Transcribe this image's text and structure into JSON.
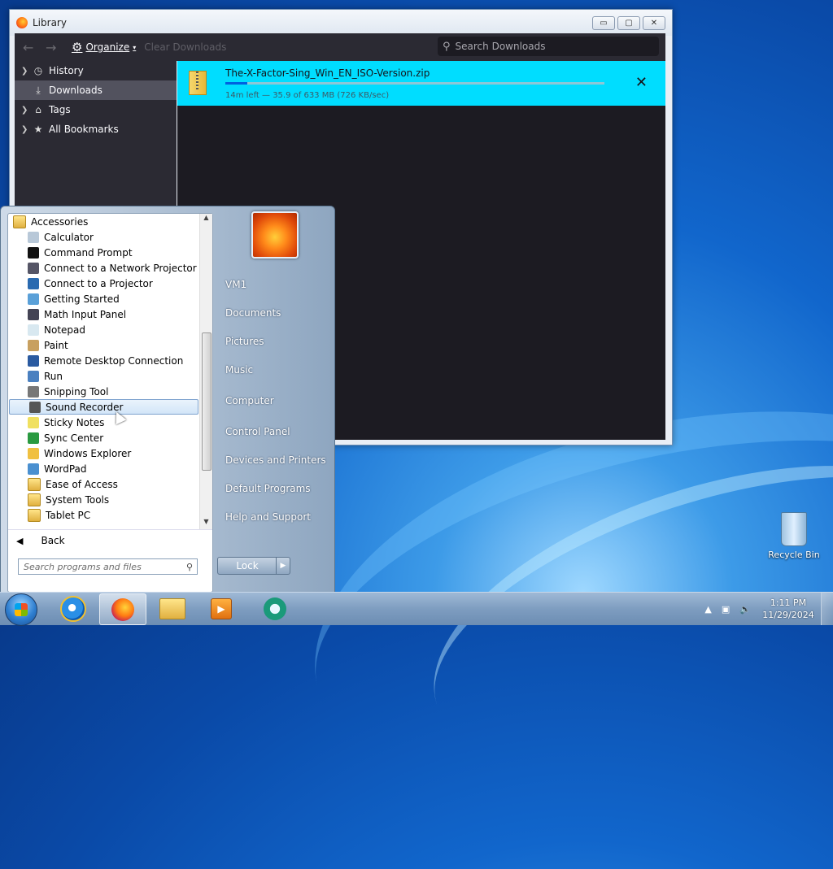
{
  "library": {
    "title": "Library",
    "organize": "Organize",
    "clear_downloads": "Clear Downloads",
    "search_placeholder": "Search Downloads",
    "sidebar": [
      {
        "label": "History",
        "icon": "history-icon",
        "chevron": true,
        "selected": false
      },
      {
        "label": "Downloads",
        "icon": "download-icon",
        "chevron": false,
        "selected": true
      },
      {
        "label": "Tags",
        "icon": "tag-icon",
        "chevron": true,
        "selected": false
      },
      {
        "label": "All Bookmarks",
        "icon": "star-icon",
        "chevron": true,
        "selected": false
      }
    ],
    "download": {
      "filename": "The-X-Factor-Sing_Win_EN_ISO-Version.zip",
      "status": "14m left — 35.9 of 633 MB (726 KB/sec)",
      "progress_percent": 5.7
    }
  },
  "start_menu": {
    "folder": "Accessories",
    "programs": [
      "Calculator",
      "Command Prompt",
      "Connect to a Network Projector",
      "Connect to a Projector",
      "Getting Started",
      "Math Input Panel",
      "Notepad",
      "Paint",
      "Remote Desktop Connection",
      "Run",
      "Snipping Tool",
      "Sound Recorder",
      "Sticky Notes",
      "Sync Center",
      "Windows Explorer",
      "WordPad",
      "Ease of Access",
      "System Tools",
      "Tablet PC"
    ],
    "highlighted": "Sound Recorder",
    "back": "Back",
    "search_placeholder": "Search programs and files",
    "right_items": [
      "VM1",
      "Documents",
      "Pictures",
      "Music",
      "Computer",
      "Control Panel",
      "Devices and Printers",
      "Default Programs",
      "Help and Support"
    ],
    "lock": "Lock"
  },
  "desktop": {
    "recycle_bin": "Recycle Bin"
  },
  "taskbar": {
    "time": "1:11 PM",
    "date": "11/29/2024"
  }
}
